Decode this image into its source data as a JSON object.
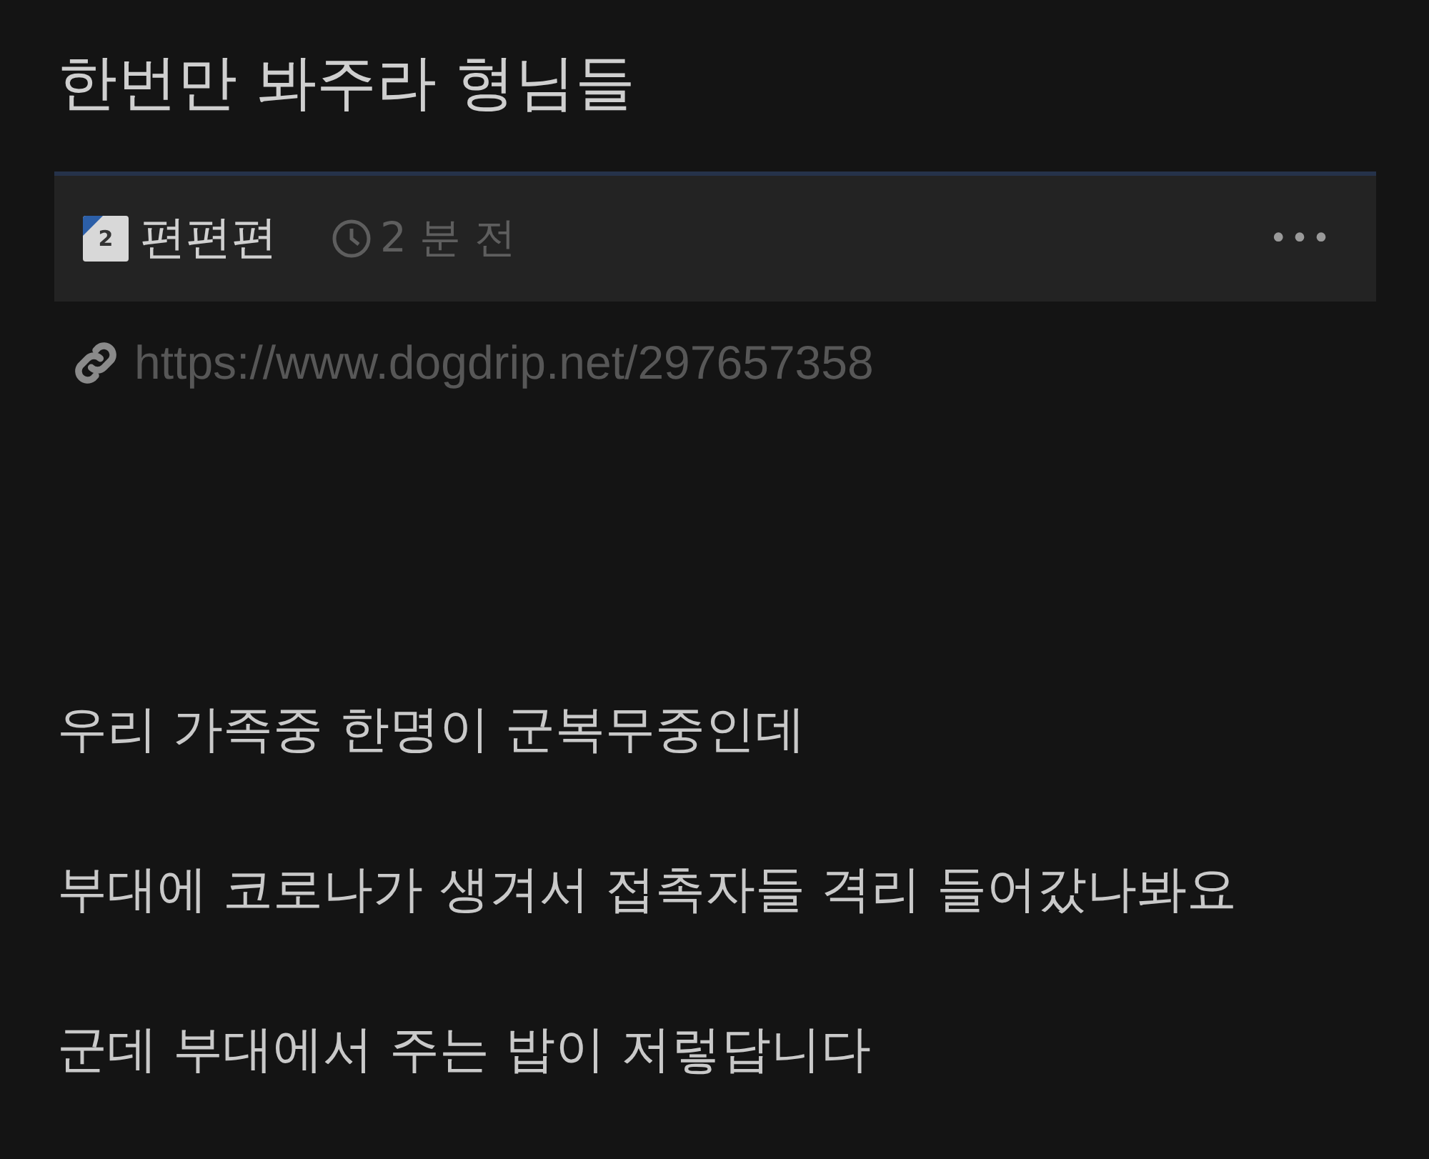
{
  "post": {
    "title": "한번만 봐주라 형님들",
    "author": {
      "level_badge": "2",
      "name": "편편편"
    },
    "time": "2 분 전",
    "more": "•••",
    "link": "https://www.dogdrip.net/297657358",
    "paragraphs": [
      "우리 가족중 한명이 군복무중인데",
      "부대에 코로나가 생겨서 접촉자들 격리 들어갔나봐요",
      "군데 부대에서 주는 밥이 저렇답니다"
    ]
  }
}
